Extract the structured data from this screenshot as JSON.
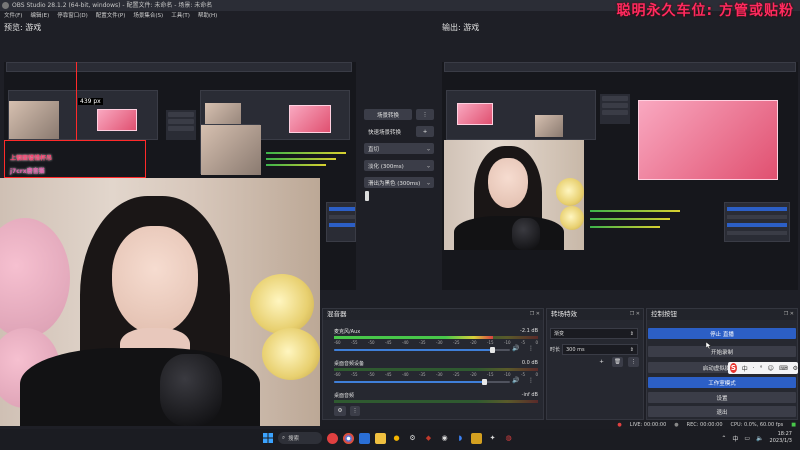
{
  "titlebar": {
    "text": "OBS Studio 28.1.2 (64-bit, windows) - 配置文件: 未命名 - 场景: 未命名"
  },
  "overlay": {
    "text": "聪明永久车位: 方管或贴粉"
  },
  "menu": {
    "items": [
      "文件(F)",
      "编辑(E)",
      "停靠窗口(D)",
      "配置文件(P)",
      "场景集合(S)",
      "工具(T)",
      "帮助(H)"
    ]
  },
  "preview": {
    "label": "预览: 游戏",
    "px_tag": "439 px",
    "chat_tag_1": "上钢面镂惜杯吊",
    "chat_tag_2": "j7crx唐音猫"
  },
  "program": {
    "label": "输出: 游戏"
  },
  "transition_panel": {
    "switch_button": "场景转换",
    "quick_label": "快速场景转换",
    "quick_add": "+",
    "options": [
      "直切",
      "淡化 (300ms)",
      "滑出为黑色 (300ms)"
    ]
  },
  "mixer": {
    "title": "混音器",
    "tracks": [
      {
        "name": "麦克风/Aux",
        "db": "-2.1 dB",
        "level": 0.78,
        "volume": 0.9
      },
      {
        "name": "桌面音频设备",
        "db": "0.0 dB",
        "level": 0.0,
        "volume": 0.85
      },
      {
        "name": "桌面音频",
        "db": "-inf dB",
        "level": 0.0,
        "volume": 0.8
      }
    ],
    "ticks": [
      "-60",
      "-55",
      "-50",
      "-45",
      "-40",
      "-35",
      "-30",
      "-25",
      "-20",
      "-15",
      "-10",
      "-5",
      "0"
    ]
  },
  "transitions": {
    "title": "转场特效",
    "selected": "渐变",
    "duration_label": "时长",
    "duration_value": "300 ms"
  },
  "controls": {
    "title": "控制按钮",
    "buttons": [
      {
        "label": "停止 直播",
        "active": true
      },
      {
        "label": "开始录制",
        "active": false
      },
      {
        "label": "启动虚拟摄像机",
        "active": false
      },
      {
        "label": "工作室模式",
        "active": true
      },
      {
        "label": "设置",
        "active": false
      },
      {
        "label": "退出",
        "active": false
      }
    ]
  },
  "status": {
    "live": "LIVE: 00:00:00",
    "rec": "REC: 00:00:00",
    "cpu": "CPU: 0.0%, 60.00 fps"
  },
  "ime": {
    "logo": "S",
    "items": [
      "中",
      "·",
      "°",
      "☺",
      "⌨",
      "⚙"
    ]
  },
  "taskbar": {
    "search": "搜索",
    "tray_lang": "中",
    "time": "18:27",
    "date": "2023/1/3"
  },
  "colors": {
    "accent": "#2c5fc6",
    "overlay_pink": "#ff2a60",
    "meter_green": "#48c84a"
  }
}
